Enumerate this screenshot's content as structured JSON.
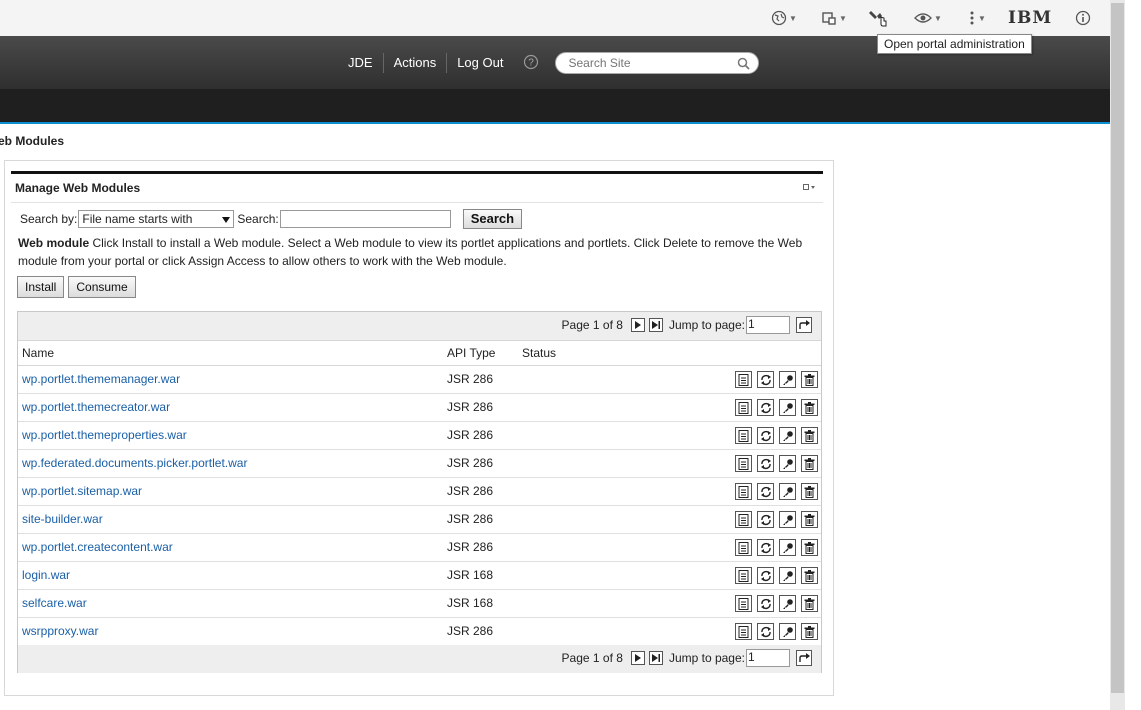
{
  "tooltip": {
    "text": "Open portal administration"
  },
  "toolbar": {
    "icons": [
      "globe-icon",
      "layout-icon",
      "wrench-icon",
      "eye-icon",
      "more-vert-icon",
      "info-icon"
    ],
    "logo": "IBM"
  },
  "header": {
    "nav": [
      "JDE",
      "Actions",
      "Log Out"
    ],
    "search_placeholder": "Search Site"
  },
  "page": {
    "title": "eb Modules"
  },
  "portlet": {
    "title": "Manage Web Modules",
    "search_by_label": "Search by:",
    "search_by_value": "File name starts with",
    "search_label": "Search:",
    "search_button": "Search",
    "description_bold": "Web module",
    "description": " Click Install to install a Web module. Select a Web module to view its portlet applications and portlets. Click Delete to remove the Web module from your portal or click Assign Access to allow others to work with the Web module.",
    "install_button": "Install",
    "consume_button": "Consume"
  },
  "pager": {
    "page_text": "Page 1 of 8",
    "jump_label": "Jump to page:",
    "jump_value": "1"
  },
  "table": {
    "columns": [
      "Name",
      "API Type",
      "Status"
    ],
    "rows": [
      {
        "name": "wp.portlet.thememanager.war",
        "api": "JSR 286",
        "status": ""
      },
      {
        "name": "wp.portlet.themecreator.war",
        "api": "JSR 286",
        "status": ""
      },
      {
        "name": "wp.portlet.themeproperties.war",
        "api": "JSR 286",
        "status": ""
      },
      {
        "name": "wp.federated.documents.picker.portlet.war",
        "api": "JSR 286",
        "status": ""
      },
      {
        "name": "wp.portlet.sitemap.war",
        "api": "JSR 286",
        "status": ""
      },
      {
        "name": "site-builder.war",
        "api": "JSR 286",
        "status": ""
      },
      {
        "name": "wp.portlet.createcontent.war",
        "api": "JSR 286",
        "status": ""
      },
      {
        "name": "login.war",
        "api": "JSR 168",
        "status": ""
      },
      {
        "name": "selfcare.war",
        "api": "JSR 168",
        "status": ""
      },
      {
        "name": "wsrpproxy.war",
        "api": "JSR 286",
        "status": ""
      }
    ]
  },
  "colors": {
    "link": "#1a5fa6",
    "accent": "#0a8fd3"
  }
}
